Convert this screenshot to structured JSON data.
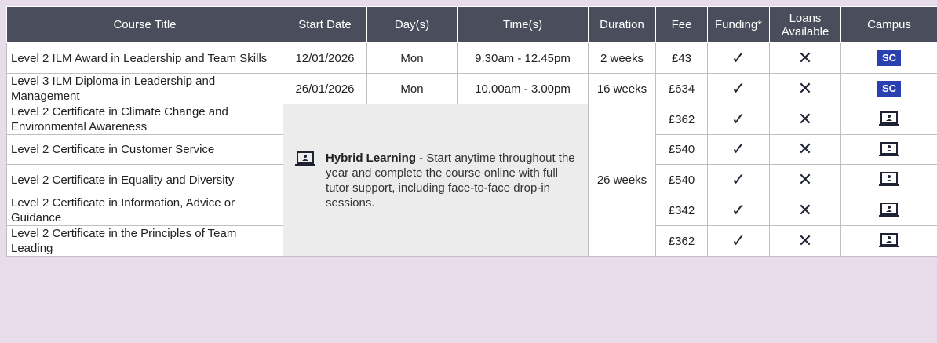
{
  "headers": {
    "course_title": "Course Title",
    "start_date": "Start Date",
    "days": "Day(s)",
    "times": "Time(s)",
    "duration": "Duration",
    "fee": "Fee",
    "funding": "Funding*",
    "loans": "Loans Available",
    "campus": "Campus"
  },
  "rows": [
    {
      "title": "Level 2 ILM Award in Leadership and Team Skills",
      "start_date": "12/01/2026",
      "days": "Mon",
      "times": "9.30am - 12.45pm",
      "duration": "2 weeks",
      "fee": "£43",
      "campus": "SC"
    },
    {
      "title": "Level 3 ILM Diploma in Leadership and Management",
      "start_date": "26/01/2026",
      "days": "Mon",
      "times": "10.00am - 3.00pm",
      "duration": "16 weeks",
      "fee": "£634",
      "campus": "SC"
    },
    {
      "title": "Level 2 Certificate in Climate Change and Environmental Awareness",
      "fee": "£362"
    },
    {
      "title": "Level 2 Certificate in Customer Service",
      "fee": "£540"
    },
    {
      "title": "Level 2 Certificate in Equality and Diversity",
      "fee": "£540"
    },
    {
      "title": "Level 2 Certificate in Information, Advice or Guidance",
      "fee": "£342"
    },
    {
      "title": "Level 2 Certificate in the Principles of Team Leading",
      "fee": "£362"
    }
  ],
  "hybrid": {
    "bold": "Hybrid Learning",
    "text": " - Start anytime throughout the year and complete the course online with full tutor support, including face-to-face drop-in sessions.",
    "duration": "26 weeks"
  },
  "icons": {
    "funding": "check-icon",
    "loans": "cross-icon",
    "online_campus": "laptop-icon"
  },
  "colors": {
    "header_bg": "#4a4d5c",
    "badge_bg": "#2a3fb0",
    "hybrid_bg": "#ececec",
    "page_bg": "#e8dcea"
  }
}
